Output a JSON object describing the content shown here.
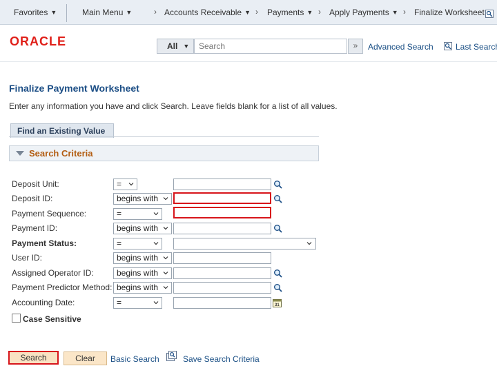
{
  "nav": {
    "favorites": "Favorites",
    "main_menu": "Main Menu",
    "crumbs": [
      "Accounts Receivable",
      "Payments",
      "Apply Payments",
      "Finalize Worksheet"
    ]
  },
  "header": {
    "logo": "ORACLE",
    "search_scope": "All",
    "search_placeholder": "Search",
    "advanced_search": "Advanced Search",
    "last_search": "Last Search"
  },
  "page": {
    "title": "Finalize Payment Worksheet",
    "instructions": "Enter any information you have and click Search. Leave fields blank for a list of all values.",
    "tab": "Find an Existing Value",
    "section": "Search Criteria"
  },
  "fields": [
    {
      "label": "Deposit Unit:",
      "operator": "=",
      "value": ""
    },
    {
      "label": "Deposit ID:",
      "operator": "begins with",
      "value": ""
    },
    {
      "label": "Payment Sequence:",
      "operator": "=",
      "value": ""
    },
    {
      "label": "Payment ID:",
      "operator": "begins with",
      "value": ""
    },
    {
      "label": "Payment Status:",
      "operator": "=",
      "value": ""
    },
    {
      "label": "User ID:",
      "operator": "begins with",
      "value": ""
    },
    {
      "label": "Assigned Operator ID:",
      "operator": "begins with",
      "value": ""
    },
    {
      "label": "Payment Predictor Method:",
      "operator": "begins with",
      "value": ""
    },
    {
      "label": "Accounting Date:",
      "operator": "=",
      "value": ""
    }
  ],
  "case_sensitive": {
    "label": "Case Sensitive",
    "checked": false
  },
  "actions": {
    "search": "Search",
    "clear": "Clear",
    "basic_search": "Basic Search",
    "save_criteria": "Save Search Criteria"
  },
  "colors": {
    "title_blue": "#1d4f86",
    "section_orange": "#b35d12",
    "error_red": "#d7141a",
    "oracle_red": "#e0201a",
    "button_bg": "#f9e2c2"
  }
}
